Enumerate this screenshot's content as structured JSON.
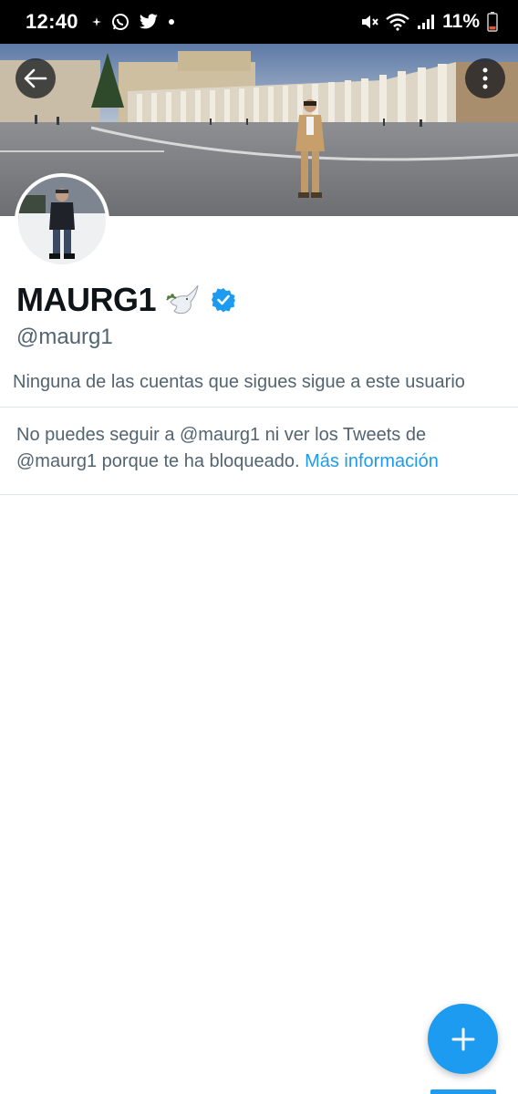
{
  "status_bar": {
    "time": "12:40",
    "battery_percent": "11%",
    "left_icons": [
      "notification-dot-icon",
      "whatsapp-icon",
      "twitter-icon",
      "dot-icon"
    ],
    "right_icons": [
      "mute-icon",
      "wifi-icon",
      "signal-icon",
      "battery-icon"
    ]
  },
  "banner": {
    "description_icon": "banner-photo",
    "back_icon": "back-arrow-icon",
    "more_icon": "more-vertical-icon"
  },
  "profile": {
    "display_name": "MAURG1",
    "name_emoji": "🕊️",
    "verified": true,
    "handle": "@maurg1",
    "followers_note": "Ninguna de las cuentas que sigues sigue a este usuario"
  },
  "blocked": {
    "message": "No puedes seguir a @maurg1 ni ver los Tweets de @maurg1 porque te ha bloqueado.",
    "link": "Más información"
  },
  "fab": {
    "icon": "plus-icon"
  },
  "colors": {
    "accent": "#1d9bf0",
    "text_primary": "#0f1419",
    "text_secondary": "#536471",
    "divider": "#e1e6ea"
  }
}
